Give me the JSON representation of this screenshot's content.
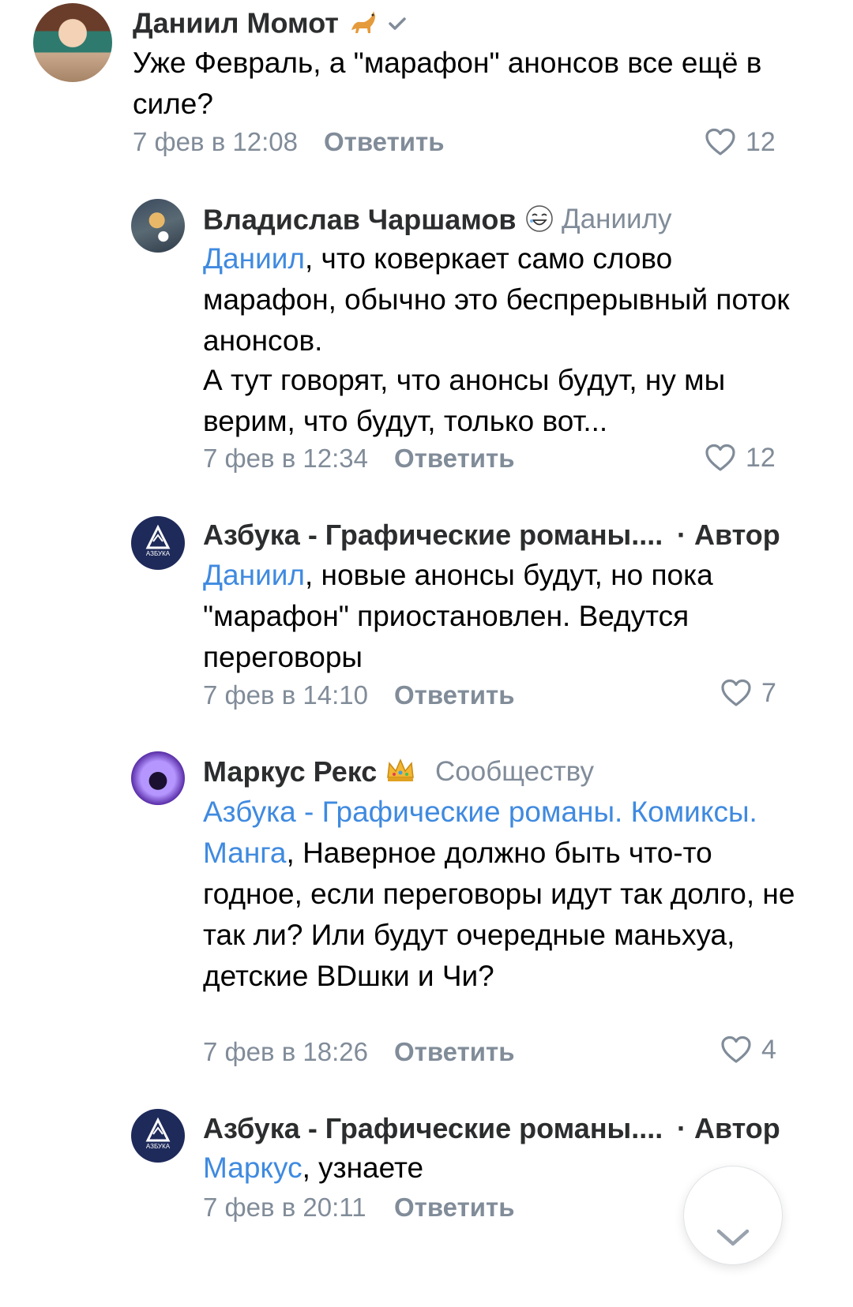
{
  "comments": [
    {
      "author": "Даниил Момот",
      "author_badge_icon": "cat-emoji",
      "verified_icon": "check-icon",
      "text": "Уже Февраль, а \"марафон\" анонсов все ещё в силе?",
      "time": "7 фев в 12:08",
      "reply_label": "Ответить",
      "likes": "12"
    },
    {
      "author": "Владислав Чаршамов",
      "author_badge_icon": "laughing-face-emoji",
      "reply_to": "Даниилу",
      "mention": "Даниил",
      "text": ", что коверкает само слово марафон, обычно это беспрерывный поток анонсов.",
      "text2": "А тут говорят, что анонсы будут, ну мы верим, что будут, только вот...",
      "time": "7 фев в 12:34",
      "reply_label": "Ответить",
      "likes": "12"
    },
    {
      "author": "Азбука - Графические романы....",
      "author_tag": "· Автор",
      "mention": "Даниил",
      "text": ", новые анонсы будут, но пока \"марафон\" приостановлен. Ведутся переговоры",
      "time": "7 фев в 14:10",
      "reply_label": "Ответить",
      "likes": "7"
    },
    {
      "author": "Маркус Рекс",
      "author_badge_icon": "crown-emoji",
      "reply_to": "Сообществу",
      "mention": "Азбука - Графические романы. Комиксы. Манга",
      "text": ", Наверное должно быть что-то годное, если переговоры идут так долго, не так ли? Или будут очередные маньхуа, детские BDшки и Чи?",
      "time": "7 фев в 18:26",
      "reply_label": "Ответить",
      "likes": "4"
    },
    {
      "author": "Азбука - Графические романы....",
      "author_tag": "· Автор",
      "mention": "Маркус",
      "text": ", узнаете",
      "time": "7 фев в 20:11",
      "reply_label": "Ответить"
    }
  ],
  "avatar_logo_text": "АЗБУКА",
  "colors": {
    "mention": "#3f8ae0",
    "secondary": "#818c99",
    "name": "#2c2d2e"
  }
}
